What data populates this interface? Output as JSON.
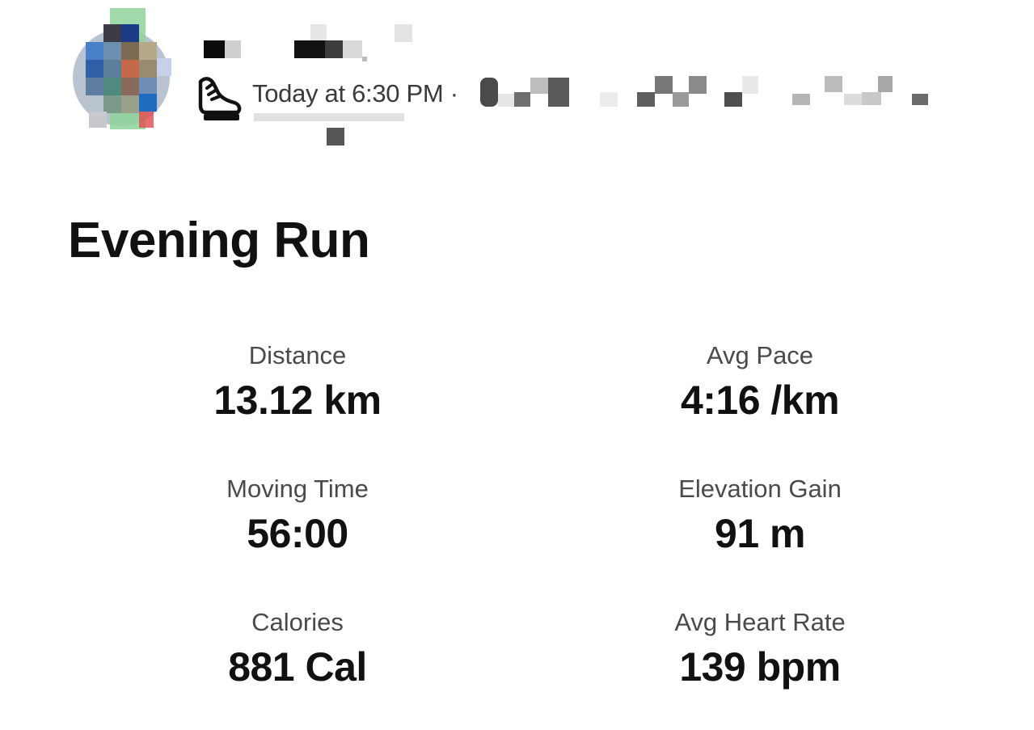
{
  "header": {
    "timestamp": "Today at 6:30 PM ·",
    "activity_icon": "running-shoe-icon"
  },
  "activity": {
    "title": "Evening Run"
  },
  "stats": [
    {
      "label": "Distance",
      "value": "13.12 km"
    },
    {
      "label": "Avg Pace",
      "value": "4:16 /km"
    },
    {
      "label": "Moving Time",
      "value": "56:00"
    },
    {
      "label": "Elevation Gain",
      "value": "91 m"
    },
    {
      "label": "Calories",
      "value": "881 Cal"
    },
    {
      "label": "Avg Heart Rate",
      "value": "139 bpm"
    }
  ],
  "colors": {
    "text_primary": "#111111",
    "text_secondary": "#4a4a4a",
    "background": "#ffffff"
  }
}
